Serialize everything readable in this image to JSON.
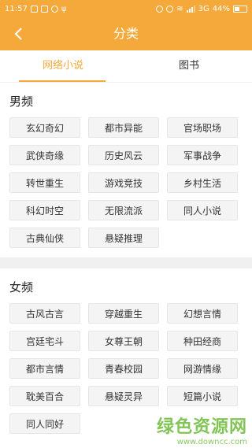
{
  "status_bar": {
    "time": "11:57",
    "network": "3G",
    "battery_percent": "44%",
    "battery_level": 0.44,
    "signal_bars": 3
  },
  "header": {
    "title": "分类",
    "back_icon": "chevron-left-icon"
  },
  "tabs": [
    {
      "label": "网络小说",
      "active": true
    },
    {
      "label": "图书",
      "active": false
    }
  ],
  "sections": [
    {
      "title": "男频",
      "items": [
        "玄幻奇幻",
        "都市异能",
        "官场职场",
        "武侠奇缘",
        "历史风云",
        "军事战争",
        "转世重生",
        "游戏竞技",
        "乡村生活",
        "科幻时空",
        "无限流派",
        "同人小说",
        "古典仙侠",
        "悬疑推理"
      ]
    },
    {
      "title": "女频",
      "items": [
        "古风古言",
        "穿越重生",
        "幻想言情",
        "宫廷宅斗",
        "女尊王朝",
        "种田经商",
        "都市言情",
        "青春校园",
        "网游情缘",
        "耽美百合",
        "悬疑灵异",
        "短篇小说",
        "同人同好"
      ]
    }
  ],
  "watermark": {
    "main": "绿色资源网",
    "sub": "www.downcc.com"
  },
  "colors": {
    "accent": "#f5a93a",
    "chip_bg": "#f4f4f4",
    "watermark": "#6dbb3a"
  }
}
